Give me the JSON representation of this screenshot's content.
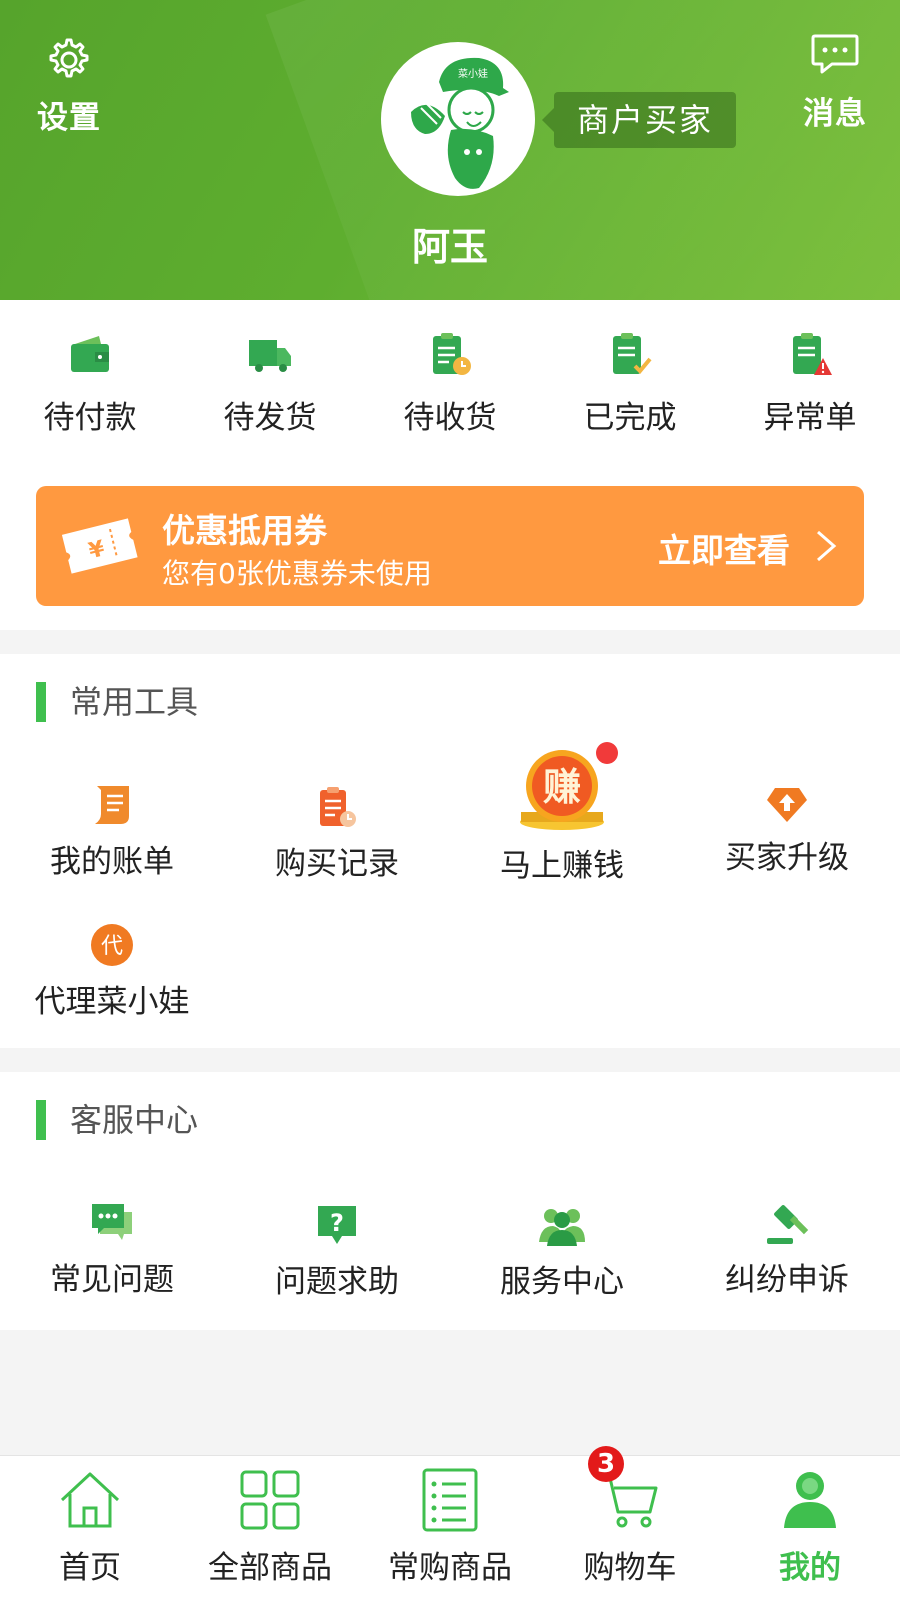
{
  "header": {
    "settings_label": "设置",
    "messages_label": "消息",
    "role_badge": "商户买家",
    "username": "阿玉",
    "avatar_text": "菜小娃",
    "brand_color": "#5ca82e"
  },
  "orders": {
    "items": [
      {
        "label": "待付款",
        "icon": "wallet-icon"
      },
      {
        "label": "待发货",
        "icon": "truck-icon"
      },
      {
        "label": "待收货",
        "icon": "clipboard-clock-icon"
      },
      {
        "label": "已完成",
        "icon": "clipboard-check-icon"
      },
      {
        "label": "异常单",
        "icon": "clipboard-warning-icon"
      }
    ]
  },
  "coupon": {
    "title": "优惠抵用券",
    "subtitle": "您有0张优惠券未使用",
    "action": "立即查看",
    "icon_text": "¥",
    "color": "#ff9940"
  },
  "tools": {
    "title": "常用工具",
    "items": [
      {
        "label": "我的账单",
        "icon": "scroll-icon"
      },
      {
        "label": "购买记录",
        "icon": "clipboard-history-icon"
      },
      {
        "label": "马上赚钱",
        "icon": "earn-coin-icon",
        "icon_text": "赚"
      },
      {
        "label": "买家升级",
        "icon": "upgrade-diamond-icon"
      },
      {
        "label": "代理菜小娃",
        "icon": "agent-icon",
        "icon_text": "代"
      }
    ]
  },
  "service": {
    "title": "客服中心",
    "items": [
      {
        "label": "常见问题",
        "icon": "chat-bubbles-icon"
      },
      {
        "label": "问题求助",
        "icon": "question-icon"
      },
      {
        "label": "服务中心",
        "icon": "people-icon"
      },
      {
        "label": "纠纷申诉",
        "icon": "gavel-icon"
      }
    ]
  },
  "nav": {
    "items": [
      {
        "label": "首页",
        "icon": "home-icon"
      },
      {
        "label": "全部商品",
        "icon": "grid-icon"
      },
      {
        "label": "常购商品",
        "icon": "list-icon"
      },
      {
        "label": "购物车",
        "icon": "cart-icon"
      },
      {
        "label": "我的",
        "icon": "user-icon"
      }
    ],
    "cart_count": "3",
    "active_color": "#3fbf4e"
  }
}
